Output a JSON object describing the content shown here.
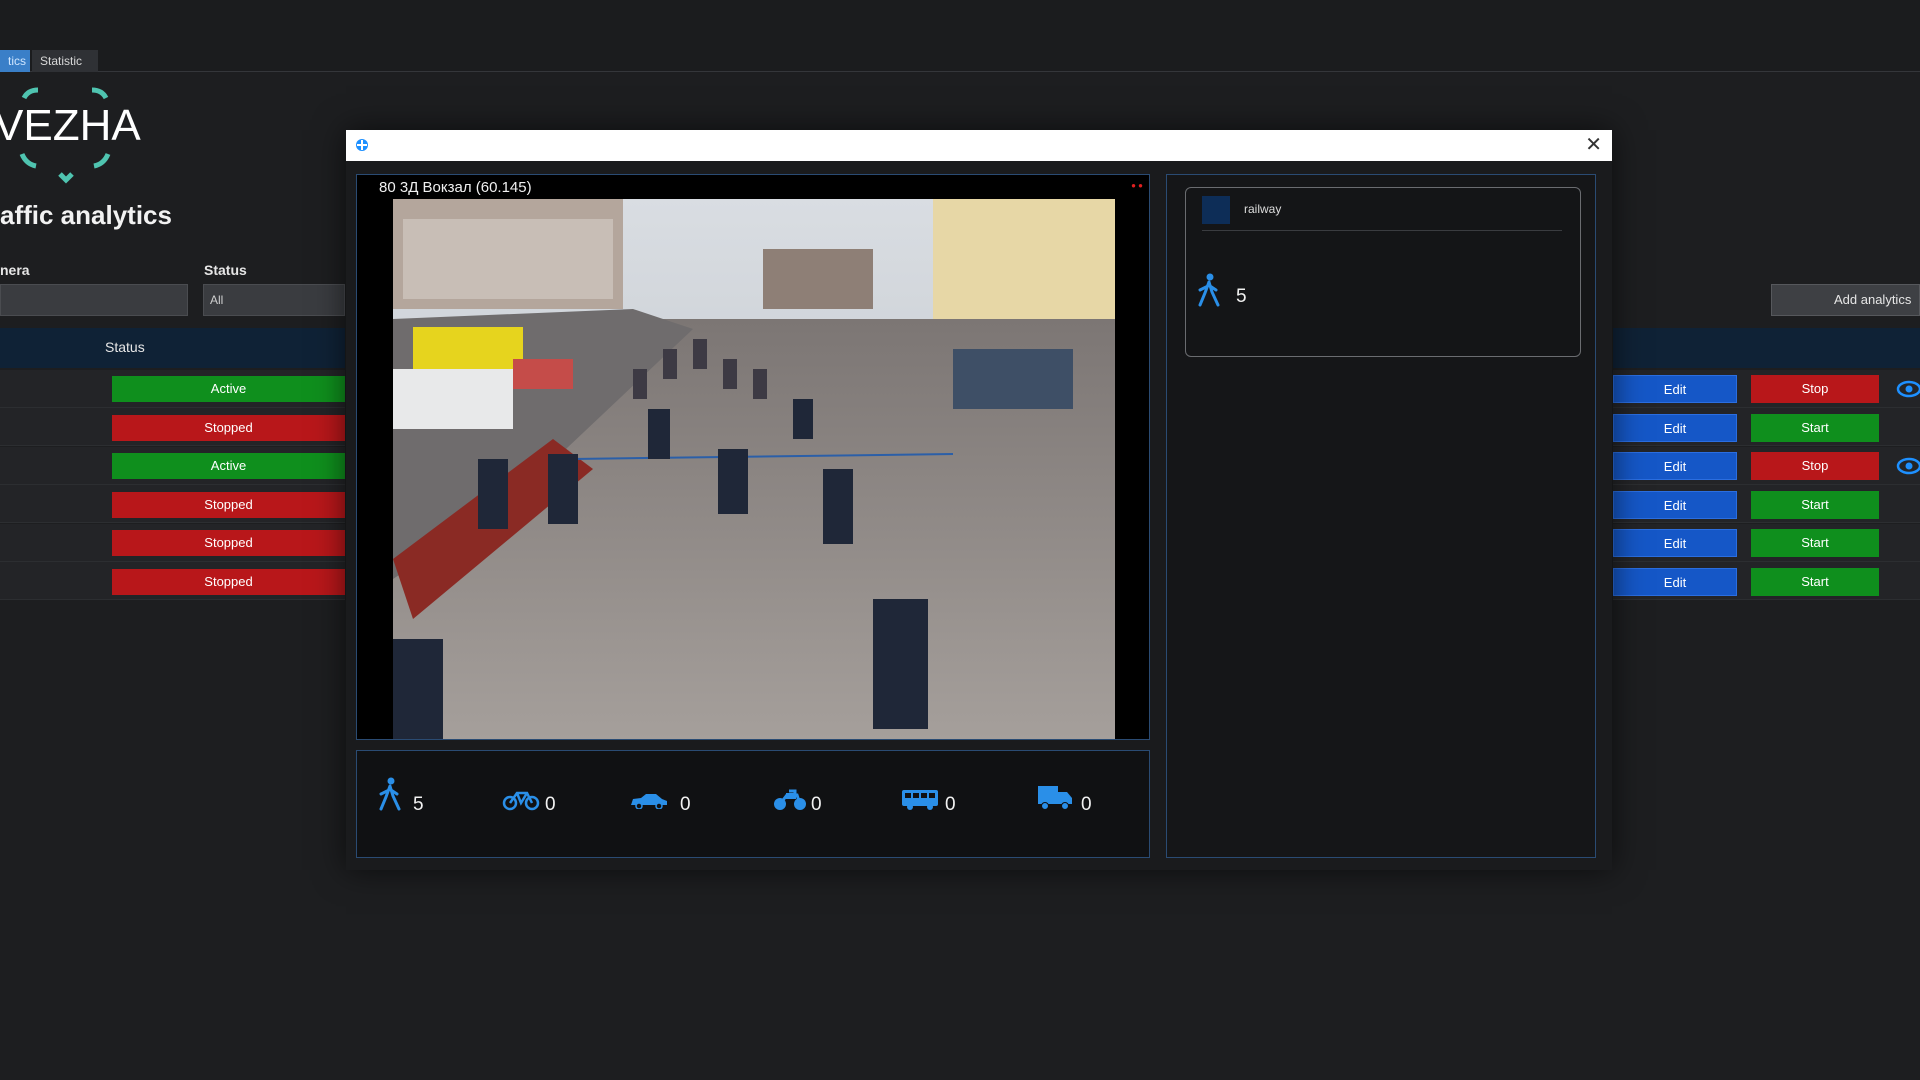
{
  "tabs": [
    {
      "label": "tics"
    },
    {
      "label": "Statistic"
    }
  ],
  "logo": {
    "text": "VEZHA"
  },
  "page": {
    "title": "affic analytics"
  },
  "filters": {
    "camera_label": "nera",
    "status_label": "Status",
    "status_value": "All"
  },
  "actions": {
    "add_label": "Add analytics"
  },
  "table": {
    "status_header": "Status",
    "rows": [
      {
        "status": "Active",
        "edit": "Edit",
        "toggle": "Stop"
      },
      {
        "status": "Stopped",
        "edit": "Edit",
        "toggle": "Start"
      },
      {
        "status": "Active",
        "edit": "Edit",
        "toggle": "Stop"
      },
      {
        "status": "Stopped",
        "edit": "Edit",
        "toggle": "Start"
      },
      {
        "status": "Stopped",
        "edit": "Edit",
        "toggle": "Start"
      },
      {
        "status": "Stopped",
        "edit": "Edit",
        "toggle": "Start"
      }
    ]
  },
  "modal": {
    "camera_title": "80 3Д Вокзал  (60.145)",
    "counts": {
      "pedestrian": "5",
      "bicycle": "0",
      "car": "0",
      "motorcycle": "0",
      "bus": "0",
      "truck": "0"
    },
    "zone": {
      "name": "railway",
      "pedestrian_count": "5"
    }
  },
  "colors": {
    "accent": "#1e90ff",
    "active": "#0f8f1d",
    "stopped": "#b8171a",
    "edit": "#1557c7"
  },
  "icons": [
    "eye-icon",
    "pedestrian-icon",
    "bicycle-icon",
    "car-icon",
    "motorcycle-icon",
    "bus-icon",
    "truck-icon",
    "close-icon",
    "app-icon"
  ]
}
